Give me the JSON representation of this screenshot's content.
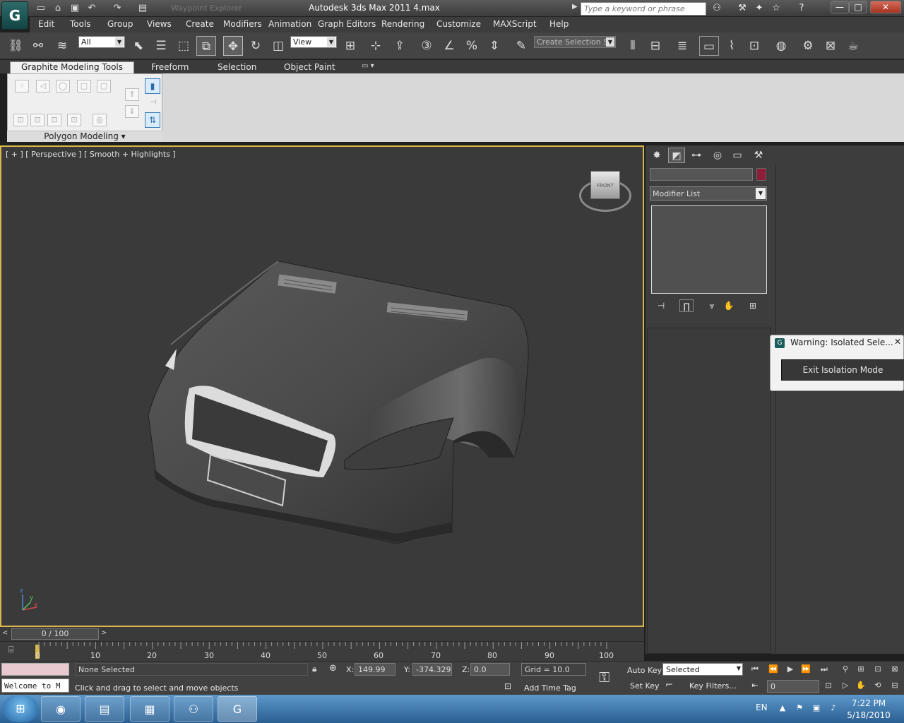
{
  "title_bar": {
    "dimmed_text": "Waypoint Explorer",
    "title": "Autodesk 3ds Max  2011      4.max",
    "search_placeholder": "Type a keyword or phrase",
    "minimize": "—",
    "maximize": "□",
    "close": "✕"
  },
  "menu": [
    "Edit",
    "Tools",
    "Group",
    "Views",
    "Create",
    "Modifiers",
    "Animation",
    "Graph Editors",
    "Rendering",
    "Customize",
    "MAXScript",
    "Help"
  ],
  "toolbar": {
    "selection_filter": "All",
    "reference_coord": "View",
    "named_selection": "Create Selection Se"
  },
  "ribbon": {
    "tabs": [
      "Graphite Modeling Tools",
      "Freeform",
      "Selection",
      "Object Paint"
    ],
    "panel_label": "Polygon Modeling"
  },
  "viewport": {
    "label": "[ + ] [ Perspective ] [ Smooth + Highlights ]",
    "viewcube_text": "FRONT",
    "axis_z": "z",
    "axis_x": "x",
    "axis_y": "y"
  },
  "command_panel": {
    "modifier_list": "Modifier List",
    "color_swatch": "#8e1d3a"
  },
  "warning_dialog": {
    "title": "Warning: Isolated Sele...",
    "button": "Exit Isolation Mode"
  },
  "timeline": {
    "slider_text": "0 / 100",
    "ticks": [
      "0",
      "10",
      "20",
      "30",
      "40",
      "50",
      "60",
      "70",
      "80",
      "90",
      "100"
    ]
  },
  "status": {
    "selection": "None Selected",
    "prompt": "Click and drag to select and move objects",
    "welcome": "Welcome to M",
    "x_label": "X:",
    "x_value": "149.99",
    "y_label": "Y:",
    "y_value": "-374.329",
    "z_label": "Z:",
    "z_value": "0.0",
    "grid": "Grid = 10.0",
    "add_time_tag": "Add Time Tag",
    "auto_key": "Auto Key",
    "set_key": "Set Key",
    "key_mode": "Selected",
    "key_filters": "Key Filters...",
    "frame": "0"
  },
  "taskbar": {
    "language": "EN",
    "time": "7:22 PM",
    "date": "5/18/2010"
  }
}
